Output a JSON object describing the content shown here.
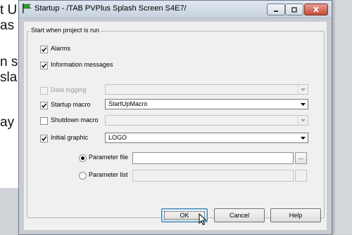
{
  "background": {
    "lines": [
      "t U",
      "as",
      "n s",
      "sla",
      "ay"
    ]
  },
  "window": {
    "title": "Startup - /TAB PVPlus Splash Screen S4E7/"
  },
  "group": {
    "legend": "Start when project is run"
  },
  "options": {
    "alarms": {
      "label": "Alarms",
      "checked": true
    },
    "info": {
      "label": "Information messages",
      "checked": true
    },
    "logging": {
      "label": "Data logging",
      "checked": false,
      "enabled": false,
      "value": ""
    },
    "startup_macro": {
      "label": "Startup macro",
      "checked": true,
      "value": "StartUpMacro"
    },
    "shutdown_macro": {
      "label": "Shutdown macro",
      "checked": false,
      "enabled": false,
      "value": ""
    },
    "initial_graphic": {
      "label": "Initial graphic",
      "checked": true,
      "value": "LOGO"
    }
  },
  "parameters": {
    "file_label": "Parameter file",
    "file_value": "",
    "list_label": "Parameter list",
    "list_value": "",
    "selected": "file",
    "browse_label": "..."
  },
  "buttons": {
    "ok": "OK",
    "cancel": "Cancel",
    "help": "Help"
  },
  "colors": {
    "titlebar": "#c7d2df",
    "close_button": "#c74b36",
    "checkmark": "#000000"
  }
}
